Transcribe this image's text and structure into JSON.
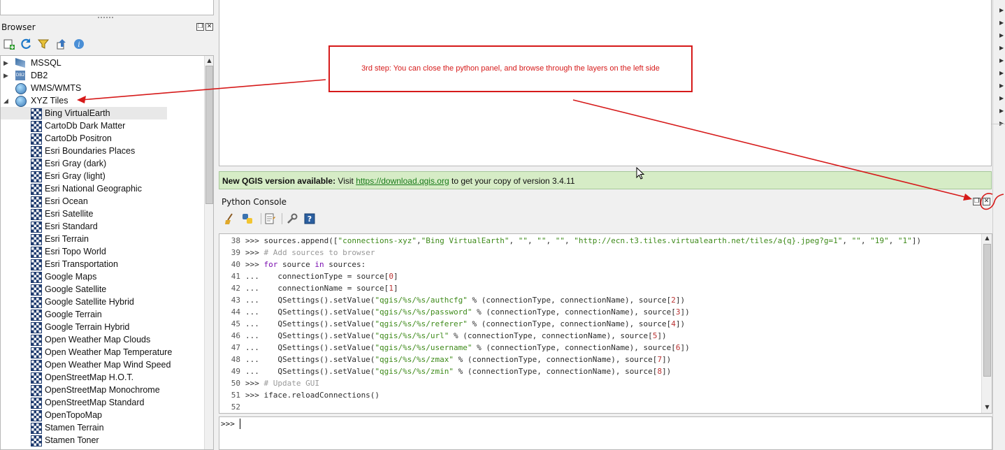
{
  "browser": {
    "title": "Browser",
    "toolbar_icons": [
      "add-layer-icon",
      "refresh-icon",
      "filter-icon",
      "collapse-all-icon",
      "info-icon"
    ],
    "items": [
      {
        "label": "MSSQL",
        "icon": "mssql-icon",
        "expand": "collapsed"
      },
      {
        "label": "DB2",
        "icon": "db2-icon",
        "expand": "collapsed"
      },
      {
        "label": "WMS/WMTS",
        "icon": "globe-icon",
        "expand": "none"
      },
      {
        "label": "XYZ Tiles",
        "icon": "globe-icon",
        "expand": "expanded"
      },
      {
        "label": "Bing VirtualEarth",
        "icon": "tile-layer-icon",
        "selected": true
      },
      {
        "label": "CartoDb Dark Matter",
        "icon": "tile-layer-icon"
      },
      {
        "label": "CartoDb Positron",
        "icon": "tile-layer-icon"
      },
      {
        "label": "Esri Boundaries Places",
        "icon": "tile-layer-icon"
      },
      {
        "label": "Esri Gray (dark)",
        "icon": "tile-layer-icon"
      },
      {
        "label": "Esri Gray (light)",
        "icon": "tile-layer-icon"
      },
      {
        "label": "Esri National Geographic",
        "icon": "tile-layer-icon"
      },
      {
        "label": "Esri Ocean",
        "icon": "tile-layer-icon"
      },
      {
        "label": "Esri Satellite",
        "icon": "tile-layer-icon"
      },
      {
        "label": "Esri Standard",
        "icon": "tile-layer-icon"
      },
      {
        "label": "Esri Terrain",
        "icon": "tile-layer-icon"
      },
      {
        "label": "Esri Topo World",
        "icon": "tile-layer-icon"
      },
      {
        "label": "Esri Transportation",
        "icon": "tile-layer-icon"
      },
      {
        "label": "Google Maps",
        "icon": "tile-layer-icon"
      },
      {
        "label": "Google Satellite",
        "icon": "tile-layer-icon"
      },
      {
        "label": "Google Satellite Hybrid",
        "icon": "tile-layer-icon"
      },
      {
        "label": "Google Terrain",
        "icon": "tile-layer-icon"
      },
      {
        "label": "Google Terrain Hybrid",
        "icon": "tile-layer-icon"
      },
      {
        "label": "Open Weather Map Clouds",
        "icon": "tile-layer-icon"
      },
      {
        "label": "Open Weather Map Temperature",
        "icon": "tile-layer-icon"
      },
      {
        "label": "Open Weather Map Wind Speed",
        "icon": "tile-layer-icon"
      },
      {
        "label": "OpenStreetMap H.O.T.",
        "icon": "tile-layer-icon"
      },
      {
        "label": "OpenStreetMap Monochrome",
        "icon": "tile-layer-icon"
      },
      {
        "label": "OpenStreetMap Standard",
        "icon": "tile-layer-icon"
      },
      {
        "label": "OpenTopoMap",
        "icon": "tile-layer-icon"
      },
      {
        "label": "Stamen Terrain",
        "icon": "tile-layer-icon"
      },
      {
        "label": "Stamen Toner",
        "icon": "tile-layer-icon"
      }
    ]
  },
  "message_bar": {
    "title": "New QGIS version available:",
    "pre_link": "Visit",
    "link": "https://download.qgis.org",
    "post_link": "to get your copy of version 3.4.11"
  },
  "python_console": {
    "title": "Python Console",
    "toolbar_icons": [
      "clear-console-icon",
      "import-class-icon",
      "show-editor-icon",
      "settings-icon",
      "help-icon"
    ],
    "prompt": ">>>",
    "lines": [
      {
        "n": "38",
        "p": ">>>",
        "t": " sources.append([\"connections-xyz\",\"Bing VirtualEarth\", \"\", \"\", \"\", \"http://ecn.t3.tiles.virtualearth.net/tiles/a{q}.jpeg?g=1\", \"\", \"19\", \"1\"])"
      },
      {
        "n": "39",
        "p": ">>>",
        "t": " # Add sources to browser"
      },
      {
        "n": "40",
        "p": ">>>",
        "t": " for source in sources:"
      },
      {
        "n": "41",
        "p": "...",
        "t": "    connectionType = source[0]"
      },
      {
        "n": "42",
        "p": "...",
        "t": "    connectionName = source[1]"
      },
      {
        "n": "43",
        "p": "...",
        "t": "    QSettings().setValue(\"qgis/%s/%s/authcfg\" % (connectionType, connectionName), source[2])"
      },
      {
        "n": "44",
        "p": "...",
        "t": "    QSettings().setValue(\"qgis/%s/%s/password\" % (connectionType, connectionName), source[3])"
      },
      {
        "n": "45",
        "p": "...",
        "t": "    QSettings().setValue(\"qgis/%s/%s/referer\" % (connectionType, connectionName), source[4])"
      },
      {
        "n": "46",
        "p": "...",
        "t": "    QSettings().setValue(\"qgis/%s/%s/url\" % (connectionType, connectionName), source[5])"
      },
      {
        "n": "47",
        "p": "...",
        "t": "    QSettings().setValue(\"qgis/%s/%s/username\" % (connectionType, connectionName), source[6])"
      },
      {
        "n": "48",
        "p": "...",
        "t": "    QSettings().setValue(\"qgis/%s/%s/zmax\" % (connectionType, connectionName), source[7])"
      },
      {
        "n": "49",
        "p": "...",
        "t": "    QSettings().setValue(\"qgis/%s/%s/zmin\" % (connectionType, connectionName), source[8])"
      },
      {
        "n": "50",
        "p": ">>>",
        "t": " # Update GUI"
      },
      {
        "n": "51",
        "p": ">>>",
        "t": " iface.reloadConnections()"
      },
      {
        "n": "52",
        "p": "",
        "t": ""
      }
    ]
  },
  "annotation": {
    "text": "3rd step: You can close the python panel, and browse through the layers on the left side",
    "color": "#d61a1a"
  },
  "colors": {
    "message_bar_bg": "#d6ecc6",
    "link": "#1a7a1a",
    "selection": "#e8e8e8"
  }
}
